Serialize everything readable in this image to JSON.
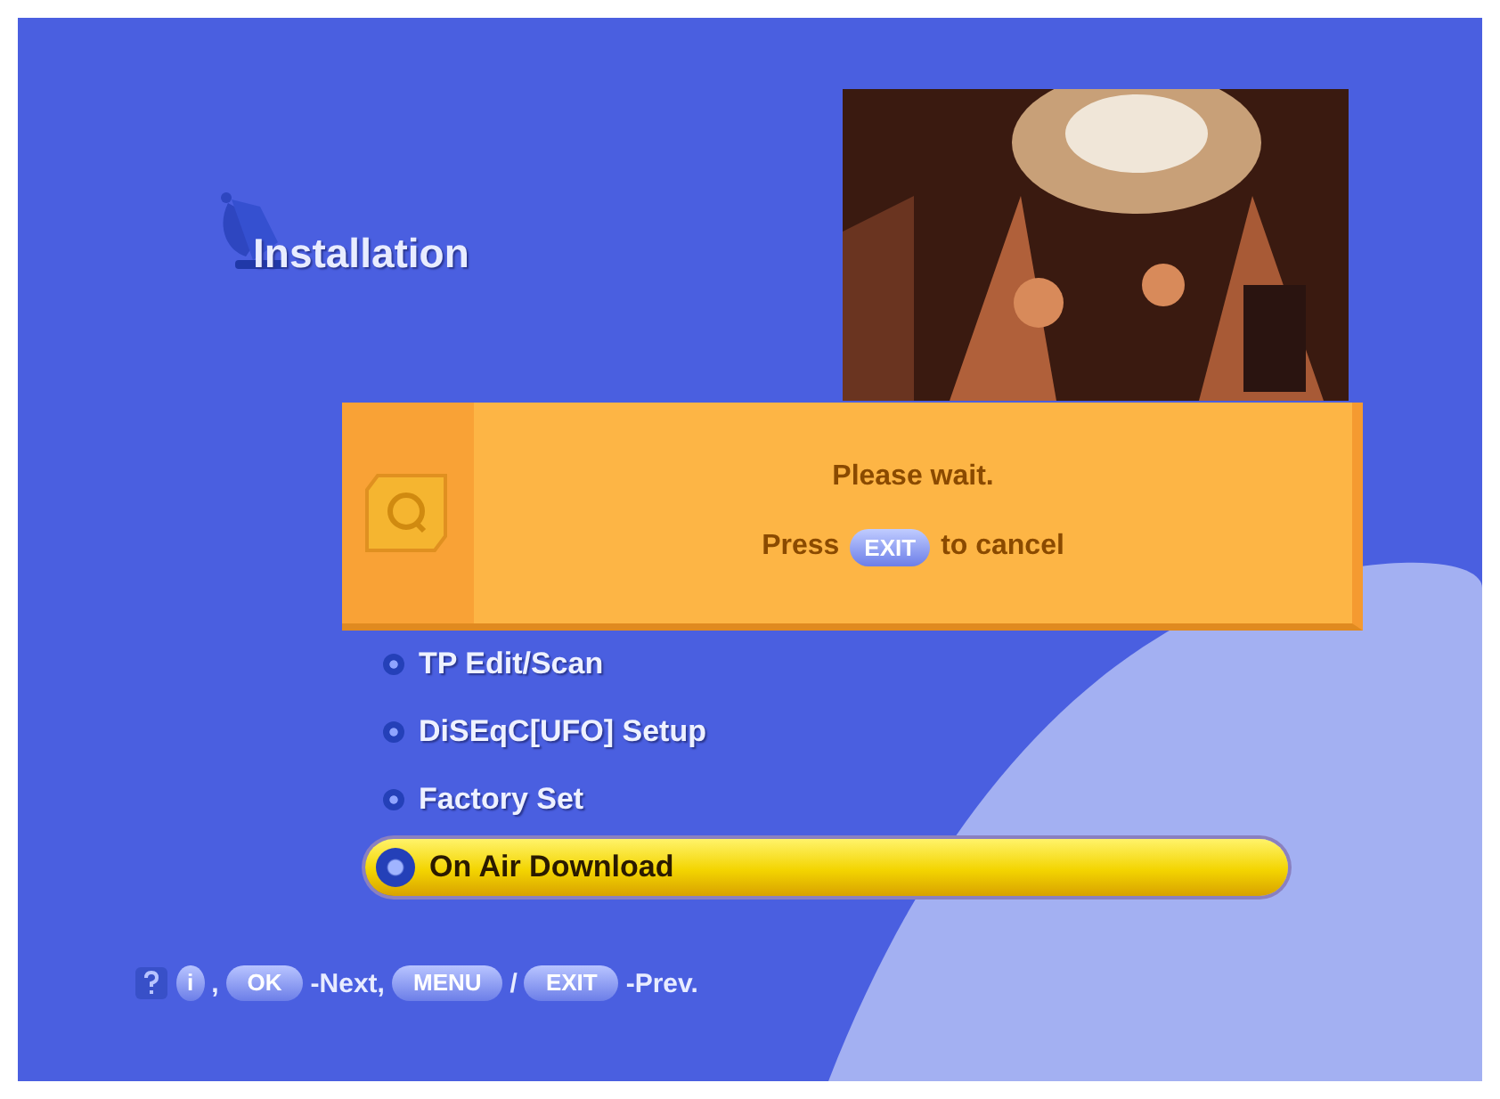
{
  "title": "Installation",
  "menu": [
    {
      "label": "TP Edit/Scan",
      "selected": false
    },
    {
      "label": "DiSEqC[UFO] Setup",
      "selected": false
    },
    {
      "label": "Factory Set",
      "selected": false
    },
    {
      "label": "On Air Download",
      "selected": true
    }
  ],
  "dialog": {
    "message": "Please wait.",
    "hint": [
      {
        "kind": "text",
        "text": "Press"
      },
      {
        "kind": "key",
        "text": "EXIT"
      },
      {
        "kind": "text",
        "text": "to cancel"
      }
    ]
  },
  "help_bar": [
    {
      "kind": "key-round",
      "text": "i"
    },
    {
      "kind": "text",
      "text": ","
    },
    {
      "kind": "key",
      "text": "OK"
    },
    {
      "kind": "text",
      "text": "-Next,"
    },
    {
      "kind": "key",
      "text": "MENU"
    },
    {
      "kind": "text",
      "text": "/"
    },
    {
      "kind": "key",
      "text": "EXIT"
    },
    {
      "kind": "text",
      "text": "-Prev."
    }
  ]
}
